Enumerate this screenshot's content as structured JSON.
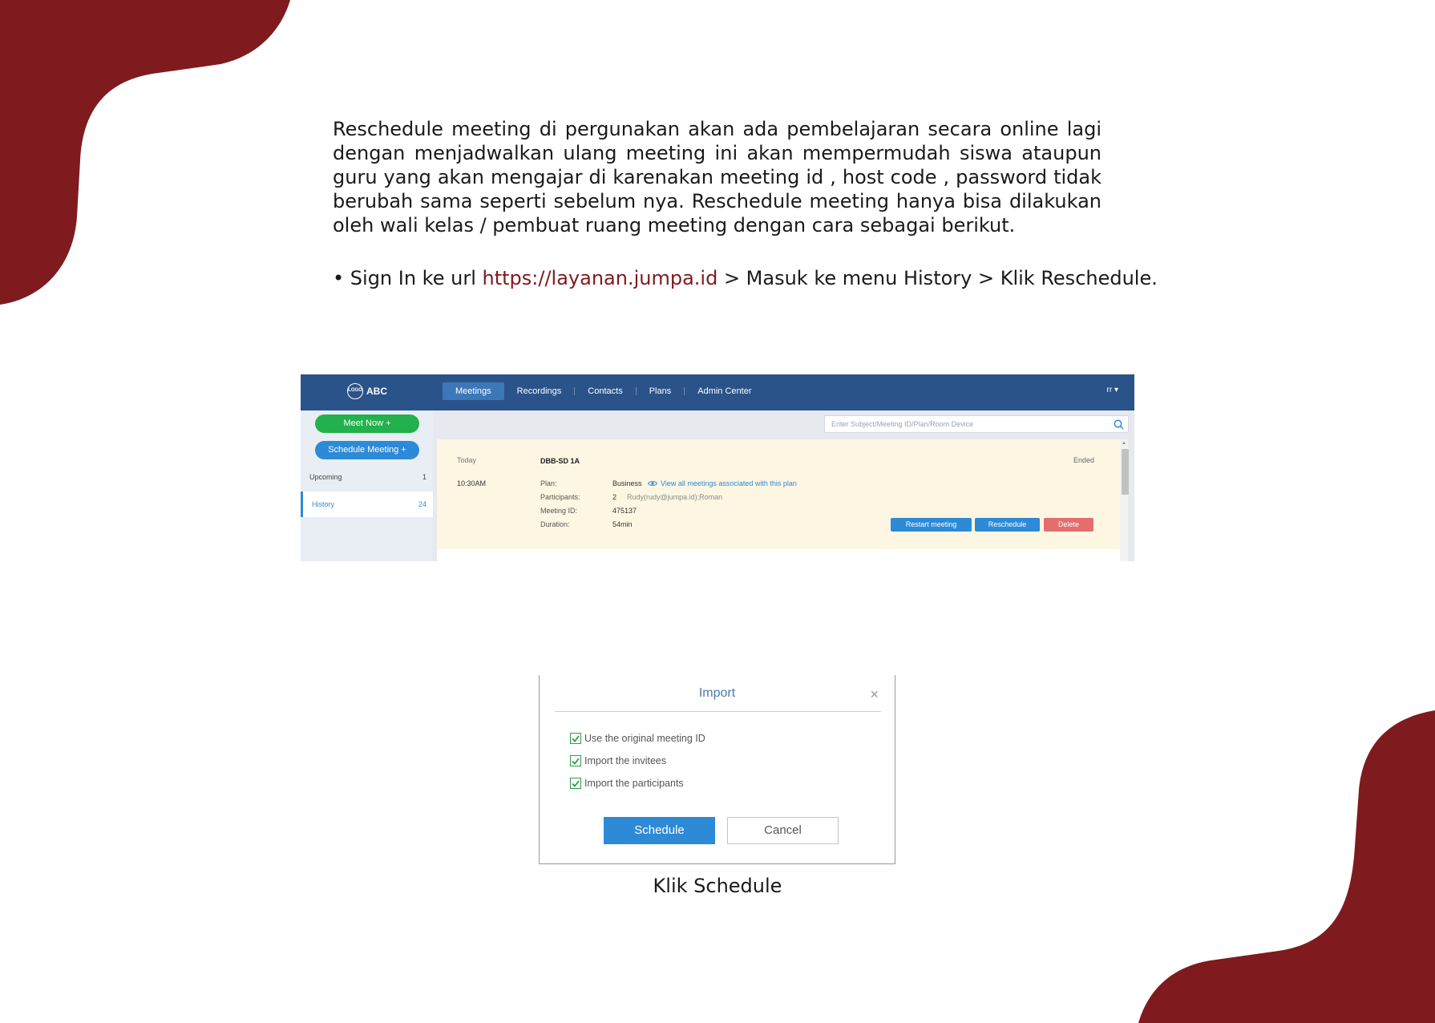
{
  "theme": {
    "accent": "#7f1a1e",
    "header_blue": "#2a5389",
    "button_blue": "#2d8ad6",
    "green": "#22b14c",
    "delete_red": "#e56d6d",
    "card_bg": "#fdf6e3"
  },
  "intro": "Reschedule meeting di pergunakan akan ada pembelajaran secara online lagi dengan menjadwalkan ulang meeting ini akan mempermudah siswa ataupun guru yang akan mengajar di karenakan meeting id , host code , password tidak berubah sama seperti sebelum nya. Reschedule meeting hanya bisa dilakukan oleh wali kelas / pembuat ruang meeting dengan cara sebagai berikut.",
  "instruction": {
    "prefix": "• Sign In ke url ",
    "url": "https://layanan.jumpa.id",
    "suffix": " > Masuk ke menu History > Klik Reschedule."
  },
  "app": {
    "logo_badge": "LOGO",
    "logo_text": "ABC",
    "nav": [
      "Meetings",
      "Recordings",
      "Contacts",
      "Plans",
      "Admin Center"
    ],
    "user_menu": "rr ▾",
    "meet_now": "Meet Now +",
    "schedule_meeting": "Schedule Meeting +",
    "sidebar": [
      {
        "label": "Upcoming",
        "count": "1"
      },
      {
        "label": "History",
        "count": "24"
      }
    ],
    "search_placeholder": "Enter Subject/Meeting ID/Plan/Room Device",
    "meeting": {
      "day": "Today",
      "time": "10:30AM",
      "subject": "DBB-SD 1A",
      "status": "Ended",
      "plan_label": "Plan:",
      "plan_value": "Business",
      "plan_link": "View all meetings associated with this plan",
      "participants_label": "Participants:",
      "participants_count": "2",
      "participants_names": "Rudy(rudy@jumpa.id);Roman",
      "meeting_id_label": "Meeting ID:",
      "meeting_id_value": "475137",
      "duration_label": "Duration:",
      "duration_value": "54min",
      "restart_label": "Restart meeting",
      "reschedule_label": "Reschedule",
      "delete_label": "Delete"
    }
  },
  "dialog": {
    "title": "Import",
    "close": "×",
    "options": [
      "Use the original meeting ID",
      "Import the invitees",
      "Import the participants"
    ],
    "schedule_label": "Schedule",
    "cancel_label": "Cancel"
  },
  "caption": "Klik Schedule"
}
